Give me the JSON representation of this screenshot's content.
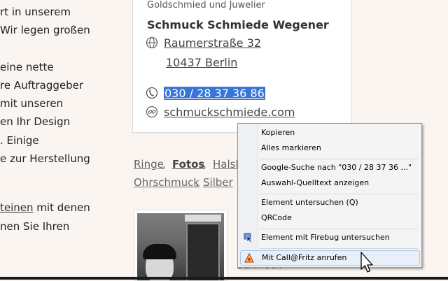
{
  "left_text": {
    "lines": [
      "rt in unserem",
      "Wir legen großen",
      "eine nette",
      "re Auftraggeber",
      "mit unseren",
      "en Ihr Design",
      ". Einige",
      "e zur Herstellung"
    ],
    "link_fragment": "teinen",
    "link_tail": " mit denen",
    "last_line": "nen Sie Ihren"
  },
  "card": {
    "subtitle": "Goldschmied und Juwelier",
    "company": "Schmuck Schmiede Wegener",
    "street": "Raumerstraße 32",
    "city": "10437 Berlin",
    "phone": "030 / 28 37 36 86",
    "website": "schmuckschmiede.com",
    "icons": {
      "address": "globe-icon",
      "phone": "phone-icon",
      "web": "link-icon"
    }
  },
  "tags": {
    "row1": [
      "Ringe",
      "Fotos",
      "Halsk"
    ],
    "row1_sep": [
      ",",
      ","
    ],
    "row2": [
      "Ohrschmuck",
      "Silber"
    ],
    "row2_sep": [
      ","
    ]
  },
  "below_photo": "Schmuck-",
  "context_menu": {
    "items": [
      {
        "id": "copy",
        "label": "Kopieren"
      },
      {
        "id": "select-all",
        "label": "Alles markieren"
      },
      {
        "id": "google-search",
        "label": "Google-Suche nach \"030 / 28 37 36 ...\""
      },
      {
        "id": "view-source",
        "label": "Auswahl-Quelltext anzeigen"
      },
      {
        "id": "inspect",
        "label": "Element untersuchen (Q)"
      },
      {
        "id": "qrcode",
        "label": "QRCode"
      },
      {
        "id": "firebug",
        "label": "Element mit Firebug untersuchen",
        "icon": "firebug-inspect-icon"
      },
      {
        "id": "callfritz",
        "label": "Mit Call@Fritz anrufen",
        "icon": "callfritz-icon",
        "highlighted": true
      }
    ]
  },
  "colors": {
    "selection": "#3875d7",
    "menu_highlight": "#e7eff8",
    "background": "#faf5f1"
  }
}
